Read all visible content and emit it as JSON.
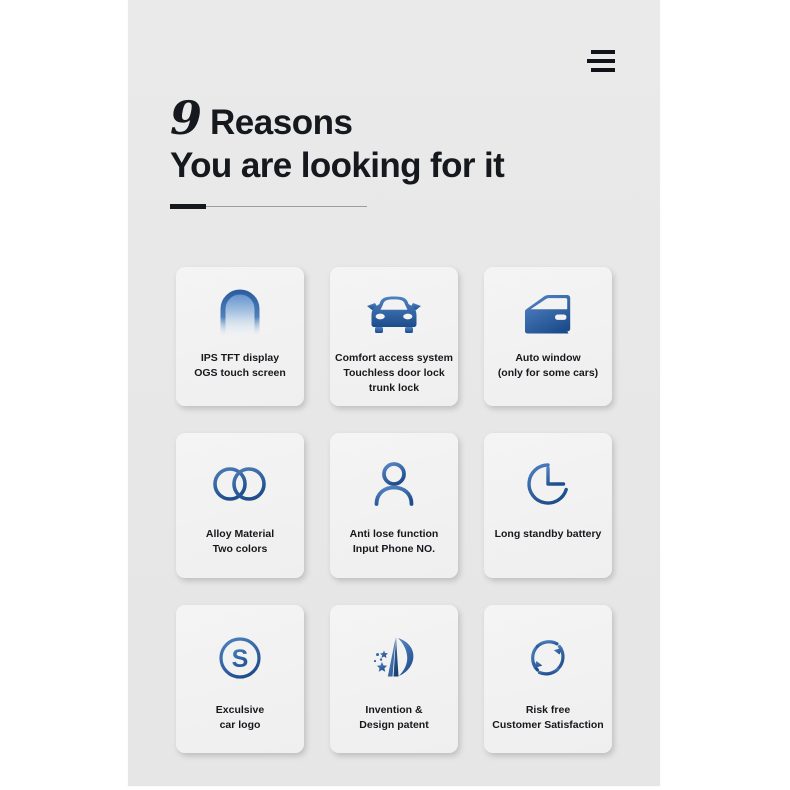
{
  "header": {
    "menu_icon": "hamburger-menu-icon",
    "headline_number": "9",
    "headline_word": "Reasons",
    "headline_line2": "You are looking for it"
  },
  "theme": {
    "page_background": "#e9e9e9",
    "card_background": "#f2f2f2",
    "text_color": "#16181c",
    "icon_gradient_start": "#4a7fc1",
    "icon_gradient_end": "#20508f"
  },
  "features": [
    {
      "icon": "tft-display-icon",
      "label": "IPS TFT display\nOGS touch screen",
      "row": "r1"
    },
    {
      "icon": "car-front-icon",
      "label": "Comfort access system\nTouchless door lock\ntrunk lock",
      "row": "r1"
    },
    {
      "icon": "car-door-icon",
      "label": "Auto window\n(only for some cars)",
      "row": "r1"
    },
    {
      "icon": "two-rings-icon",
      "label": "Alloy Material\nTwo colors",
      "row": "r2"
    },
    {
      "icon": "person-icon",
      "label": "Anti lose function\nInput Phone NO.",
      "row": "r2"
    },
    {
      "icon": "clock-icon",
      "label": "Long standby battery",
      "row": "r2"
    },
    {
      "icon": "s-logo-circle-icon",
      "label": "Exculsive\ncar logo",
      "row": "r3"
    },
    {
      "icon": "patent-star-icon",
      "label": "Invention &\nDesign patent",
      "row": "r3"
    },
    {
      "icon": "refresh-cycle-icon",
      "label": "Risk free\nCustomer Satisfaction",
      "row": "r3"
    }
  ]
}
